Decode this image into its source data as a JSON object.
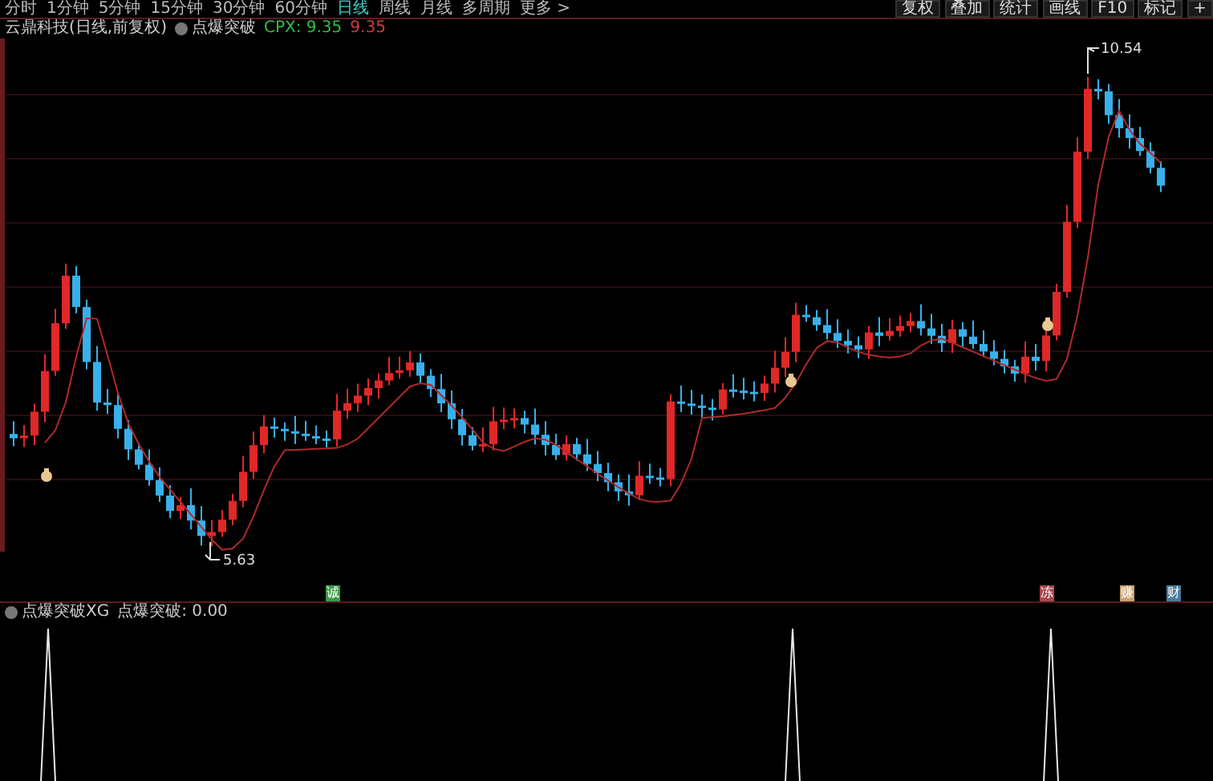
{
  "period_tabs": [
    {
      "label": "分时",
      "selected": false
    },
    {
      "label": "1分钟",
      "selected": false
    },
    {
      "label": "5分钟",
      "selected": false
    },
    {
      "label": "15分钟",
      "selected": false
    },
    {
      "label": "30分钟",
      "selected": false
    },
    {
      "label": "60分钟",
      "selected": false
    },
    {
      "label": "日线",
      "selected": true
    },
    {
      "label": "周线",
      "selected": false
    },
    {
      "label": "月线",
      "selected": false
    },
    {
      "label": "多周期",
      "selected": false
    },
    {
      "label": "更多 >",
      "selected": false
    }
  ],
  "toolbar": [
    "复权",
    "叠加",
    "统计",
    "画线",
    "F10",
    "标记",
    "+"
  ],
  "main_chart": {
    "title": "云鼎科技(日线,前复权)",
    "indicator": "点爆突破",
    "readings": [
      {
        "label": "CPX: 9.35",
        "color": "#2fbf4a"
      },
      {
        "label": "9.35",
        "color": "#d23b3b"
      }
    ],
    "high_label": "10.54",
    "low_label": "5.63"
  },
  "signal_markers": [
    {
      "char": "诚",
      "color": "#3a9a48"
    },
    {
      "char": "冻",
      "color": "#a8484c"
    },
    {
      "char": "赚",
      "color": "#c8a070"
    },
    {
      "char": "财",
      "color": "#4a7a9a"
    }
  ],
  "lower_panel": {
    "title": "点爆突破XG",
    "reading": "点爆突破: 0.00"
  }
}
